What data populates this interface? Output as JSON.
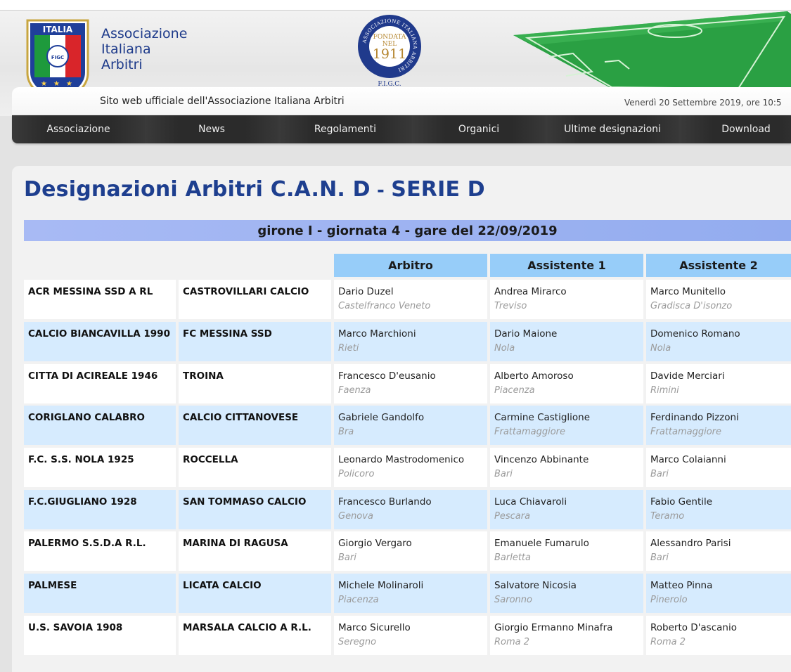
{
  "header": {
    "crest_word": "ITALIA",
    "crest_badge": "FIGC",
    "brand_lines": [
      "Associazione",
      "Italiana",
      "Arbitri"
    ],
    "seal_lines": [
      "FONDATA",
      "NEL",
      "1911"
    ],
    "seal_ring": "ASSOCIAZIONE ITALIANA ARBITRI",
    "seal_bottom": "F.I.G.C.",
    "subtitle": "Sito web ufficiale dell'Associazione Italiana Arbitri",
    "date": "Venerdì 20 Settembre 2019, ore 10:5"
  },
  "nav": [
    {
      "label": "Associazione"
    },
    {
      "label": "News"
    },
    {
      "label": "Regolamenti"
    },
    {
      "label": "Organici"
    },
    {
      "label": "Ultime designazioni"
    },
    {
      "label": "Download"
    }
  ],
  "page": {
    "title_main": "Designazioni Arbitri C.A.N. D",
    "title_sep": " - ",
    "title_series": "SERIE D",
    "round": "girone I - giornata 4 - gare del 22/09/2019",
    "columns": {
      "referee": "Arbitro",
      "assistant1": "Assistente 1",
      "assistant2": "Assistente 2"
    }
  },
  "colors": {
    "row_alt": "#d6ebfe",
    "row": "#ffffff",
    "title": "#1e3f8f",
    "header_bar": "#97cdf9"
  },
  "matches": [
    {
      "home": "ACR MESSINA SSD A RL",
      "away": "CASTROVILLARI CALCIO",
      "referee": {
        "name": "Dario Duzel",
        "city": "Castelfranco Veneto"
      },
      "assistant1": {
        "name": "Andrea Mirarco",
        "city": "Treviso"
      },
      "assistant2": {
        "name": "Marco Munitello",
        "city": "Gradisca D'isonzo"
      }
    },
    {
      "home": "CALCIO BIANCAVILLA 1990",
      "away": "FC MESSINA SSD",
      "referee": {
        "name": "Marco Marchioni",
        "city": "Rieti"
      },
      "assistant1": {
        "name": "Dario Maione",
        "city": "Nola"
      },
      "assistant2": {
        "name": "Domenico Romano",
        "city": "Nola"
      }
    },
    {
      "home": "CITTA DI ACIREALE 1946",
      "away": "TROINA",
      "referee": {
        "name": "Francesco D'eusanio",
        "city": "Faenza"
      },
      "assistant1": {
        "name": "Alberto Amoroso",
        "city": "Piacenza"
      },
      "assistant2": {
        "name": "Davide Merciari",
        "city": "Rimini"
      }
    },
    {
      "home": "CORIGLANO CALABRO",
      "away": "CALCIO CITTANOVESE",
      "referee": {
        "name": "Gabriele Gandolfo",
        "city": "Bra"
      },
      "assistant1": {
        "name": "Carmine Castiglione",
        "city": "Frattamaggiore"
      },
      "assistant2": {
        "name": "Ferdinando Pizzoni",
        "city": "Frattamaggiore"
      }
    },
    {
      "home": "F.C. S.S. NOLA 1925",
      "away": "ROCCELLA",
      "referee": {
        "name": "Leonardo Mastrodomenico",
        "city": "Policoro"
      },
      "assistant1": {
        "name": "Vincenzo Abbinante",
        "city": "Bari"
      },
      "assistant2": {
        "name": "Marco Colaianni",
        "city": "Bari"
      }
    },
    {
      "home": "F.C.GIUGLIANO 1928",
      "away": "SAN TOMMASO CALCIO",
      "referee": {
        "name": "Francesco Burlando",
        "city": "Genova"
      },
      "assistant1": {
        "name": "Luca Chiavaroli",
        "city": "Pescara"
      },
      "assistant2": {
        "name": "Fabio Gentile",
        "city": "Teramo"
      }
    },
    {
      "home": "PALERMO S.S.D.A R.L.",
      "away": "MARINA DI RAGUSA",
      "referee": {
        "name": "Giorgio Vergaro",
        "city": "Bari"
      },
      "assistant1": {
        "name": "Emanuele Fumarulo",
        "city": "Barletta"
      },
      "assistant2": {
        "name": "Alessandro Parisi",
        "city": "Bari"
      }
    },
    {
      "home": "PALMESE",
      "away": "LICATA CALCIO",
      "referee": {
        "name": "Michele Molinaroli",
        "city": "Piacenza"
      },
      "assistant1": {
        "name": "Salvatore Nicosia",
        "city": "Saronno"
      },
      "assistant2": {
        "name": "Matteo Pinna",
        "city": "Pinerolo"
      }
    },
    {
      "home": "U.S. SAVOIA 1908",
      "away": "MARSALA CALCIO A R.L.",
      "referee": {
        "name": "Marco Sicurello",
        "city": "Seregno"
      },
      "assistant1": {
        "name": "Giorgio Ermanno Minafra",
        "city": "Roma 2"
      },
      "assistant2": {
        "name": "Roberto D'ascanio",
        "city": "Roma 2"
      }
    }
  ]
}
